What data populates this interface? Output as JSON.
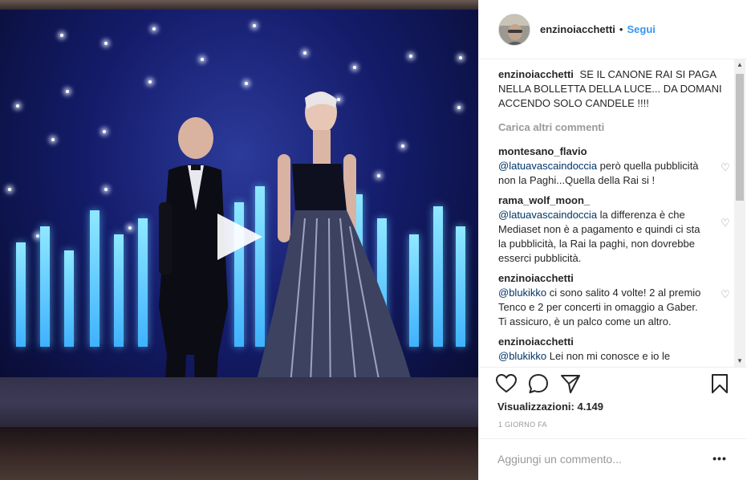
{
  "post": {
    "username": "enzinoiacchetti",
    "separator": "•",
    "follow_label": "Segui"
  },
  "caption": {
    "username": "enzinoiacchetti",
    "text": "SE IL CANONE RAI SI PAGA NELLA BOLLETTA DELLA LUCE... DA DOMANI ACCENDO SOLO CANDELE !!!!"
  },
  "load_more_label": "Carica altri commenti",
  "comments": [
    {
      "username": "montesano_flavio",
      "mention": "@latuavascaindoccia",
      "text": "però quella pubblicità non la Paghi...Quella della Rai si !"
    },
    {
      "username": "rama_wolf_moon_",
      "mention": "@latuavascaindoccia",
      "text": "la differenza è che Mediaset non è a pagamento e quindi ci sta la pubblicità, la Rai la paghi, non dovrebbe esserci pubblicità."
    },
    {
      "username": "enzinoiacchetti",
      "mention": "@blukikko",
      "text": "ci sono salito 4 volte! 2 al premio Tenco e 2 per concerti in omaggio a Gaber. Ti assicuro, è un palco come un altro."
    },
    {
      "username": "enzinoiacchetti",
      "mention": "@blukikko",
      "text": "Lei non mi conosce e io le perdono per questo e"
    }
  ],
  "views": {
    "label": "Visualizzazioni:",
    "count": "4.149"
  },
  "time_ago": "1 GIORNO FA",
  "composer": {
    "placeholder": "Aggiungi un commento...",
    "more_label": "•••"
  },
  "icons": {
    "like": "heart-icon",
    "comment": "comment-icon",
    "share": "share-icon",
    "save": "bookmark-icon",
    "play": "play-icon",
    "comment_like": "heart-icon"
  }
}
